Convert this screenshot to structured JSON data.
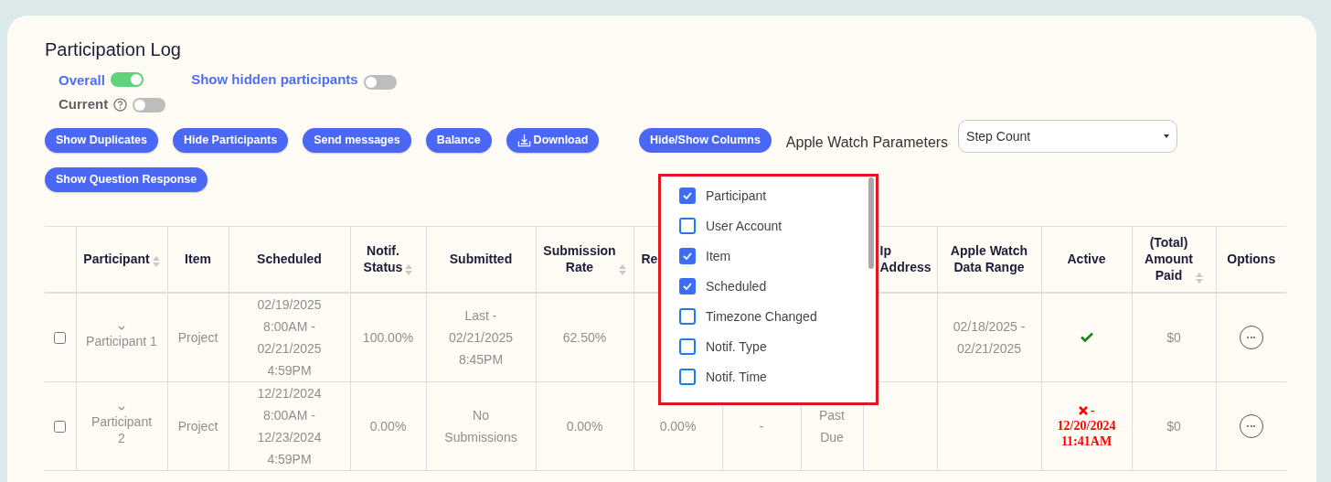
{
  "title": "Participation Log",
  "toggles": [
    {
      "label": "Overall",
      "on": true,
      "help": false
    },
    {
      "label": "Current",
      "on": false,
      "help": true
    },
    {
      "label": "Show hidden participants",
      "on": false,
      "help": false
    }
  ],
  "buttons": [
    {
      "label": "Show Duplicates",
      "kind": "plain"
    },
    {
      "label": "Hide Participants",
      "kind": "plain"
    },
    {
      "label": "Send messages",
      "kind": "plain"
    },
    {
      "label": "Balance",
      "kind": "plain"
    },
    {
      "label": "Download",
      "kind": "download"
    },
    {
      "label": "Show Question Response",
      "kind": "plain"
    }
  ],
  "columns_button": {
    "label": "Hide/Show Columns"
  },
  "apple_watch": {
    "label": "Apple Watch Parameters",
    "value": "Step Count"
  },
  "columns_menu": [
    {
      "label": "Participant",
      "checked": true
    },
    {
      "label": "User Account",
      "checked": false
    },
    {
      "label": "Item",
      "checked": true
    },
    {
      "label": "Scheduled",
      "checked": true
    },
    {
      "label": "Timezone Changed",
      "checked": false
    },
    {
      "label": "Notif. Type",
      "checked": false
    },
    {
      "label": "Notif. Time",
      "checked": false
    }
  ],
  "table": {
    "columns": [
      {
        "label": "Participant",
        "sortable": true
      },
      {
        "label": "Item",
        "sortable": false
      },
      {
        "label": "Scheduled",
        "sortable": false
      },
      {
        "label": "Notif.\nStatus",
        "sortable": true
      },
      {
        "label": "Submitted",
        "sortable": false
      },
      {
        "label": "Submission\nRate",
        "sortable": true
      },
      {
        "label": "Re"
      },
      {},
      {},
      {
        "label": "Ip\nAddress",
        "sortable": false
      },
      {
        "label": "Apple Watch\nData Range",
        "sortable": false
      },
      {
        "label": "Active",
        "sortable": false
      },
      {
        "label": "(Total)\nAmount\nPaid",
        "sortable": true
      },
      {
        "label": "Options",
        "sortable": false
      }
    ],
    "rows": [
      {
        "checked": false,
        "cells": [
          {
            "kind": "participant",
            "text": "Participant 1"
          },
          {
            "kind": "text",
            "text": "Project"
          },
          {
            "kind": "text",
            "text": "02/19/2025\n8:00AM -\n02/21/2025\n4:59PM"
          },
          {
            "kind": "text",
            "text": "100.00%"
          },
          {
            "kind": "text",
            "text": "Last -\n02/21/2025\n8:45PM"
          },
          {
            "kind": "text",
            "text": "62.50%"
          },
          {
            "kind": "empty"
          },
          {
            "kind": "empty"
          },
          {
            "kind": "empty"
          },
          {
            "kind": "empty"
          },
          {
            "kind": "text",
            "text": "02/18/2025 -\n02/21/2025"
          },
          {
            "kind": "active",
            "active": true
          },
          {
            "kind": "text",
            "text": "$0"
          },
          {
            "kind": "options"
          }
        ]
      },
      {
        "checked": false,
        "cells": [
          {
            "kind": "participant",
            "text": "Participant\n2"
          },
          {
            "kind": "text",
            "text": "Project"
          },
          {
            "kind": "text",
            "text": "12/21/2024\n8:00AM -\n12/23/2024\n4:59PM"
          },
          {
            "kind": "text",
            "text": "0.00%"
          },
          {
            "kind": "text",
            "text": "No\nSubmissions"
          },
          {
            "kind": "text",
            "text": "0.00%"
          },
          {
            "kind": "text",
            "text": "0.00%"
          },
          {
            "kind": "text",
            "text": "-"
          },
          {
            "kind": "text",
            "text": "Past\nDue"
          },
          {
            "kind": "empty"
          },
          {
            "kind": "empty"
          },
          {
            "kind": "active",
            "active": false,
            "text": "- 12/20/2024 11:41AM"
          },
          {
            "kind": "text",
            "text": "$0"
          },
          {
            "kind": "options"
          }
        ]
      }
    ]
  }
}
